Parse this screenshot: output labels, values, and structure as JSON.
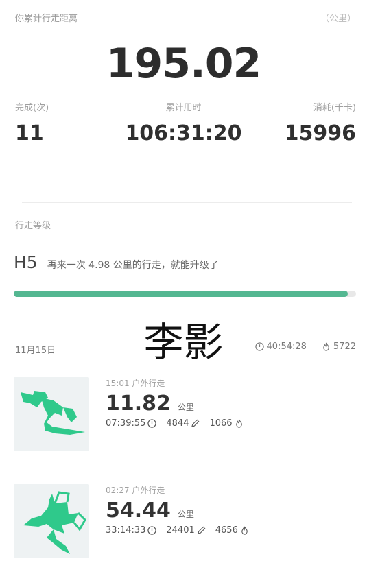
{
  "summary": {
    "title": "你累计行走距离",
    "unit": "（公里）",
    "total_distance": "195.02",
    "stats": [
      {
        "label": "完成(次)",
        "value": "11"
      },
      {
        "label": "累计用时",
        "value": "106:31:20"
      },
      {
        "label": "消耗(千卡)",
        "value": "15996"
      }
    ]
  },
  "level": {
    "heading": "行走等级",
    "code": "H5",
    "message": "再来一次 4.98 公里的行走，就能升级了",
    "progress": 0.975,
    "progress_color": "#54b791"
  },
  "watermark": "李影",
  "day": {
    "date": "11月15日",
    "duration": "40:54:28",
    "duration_icon": "clock-icon",
    "calories": "5722",
    "calories_icon": "flame-icon"
  },
  "records": [
    {
      "time": "15:01",
      "type": "户外行走",
      "distance": "11.82",
      "unit": "公里",
      "duration": "07:39:55",
      "steps": "4844",
      "calories": "1066"
    },
    {
      "time": "02:27",
      "type": "户外行走",
      "distance": "54.44",
      "unit": "公里",
      "duration": "33:14:33",
      "steps": "24401",
      "calories": "4656"
    }
  ],
  "colors": {
    "route": "#2fc98b",
    "accent": "#54b791"
  }
}
